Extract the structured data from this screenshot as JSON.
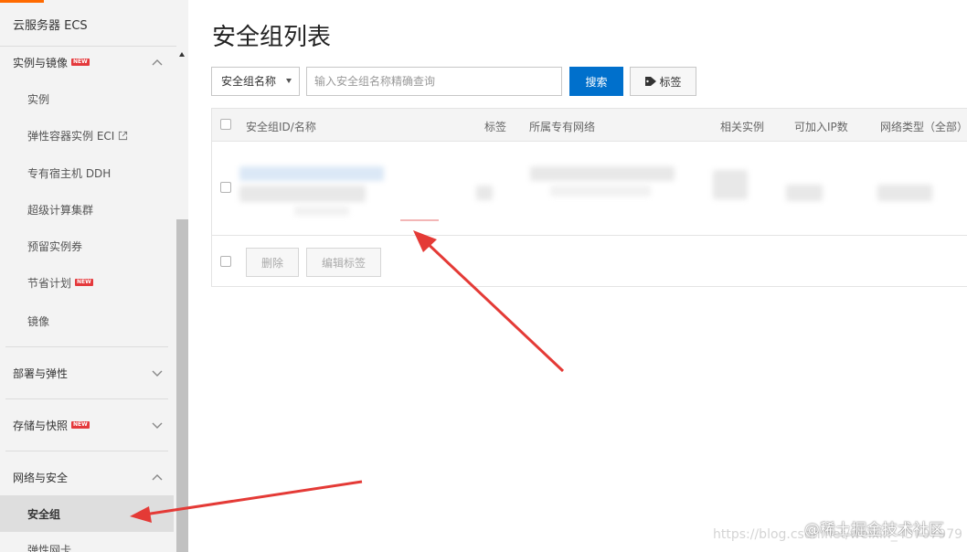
{
  "sidebar": {
    "product_title": "云服务器 ECS",
    "badge_new": "NEW",
    "sections": [
      {
        "label": "实例与镜像",
        "expanded": true,
        "has_new": true
      },
      {
        "label": "部署与弹性",
        "expanded": false,
        "has_new": false
      },
      {
        "label": "存储与快照",
        "expanded": false,
        "has_new": true
      },
      {
        "label": "网络与安全",
        "expanded": true,
        "has_new": false
      }
    ],
    "items": [
      {
        "label": "实例"
      },
      {
        "label": "弹性容器实例 ECI",
        "external_icon": "external-link-icon"
      },
      {
        "label": "专有宿主机 DDH"
      },
      {
        "label": "超级计算集群"
      },
      {
        "label": "预留实例券"
      },
      {
        "label": "节省计划",
        "has_new": true
      },
      {
        "label": "镜像"
      }
    ],
    "active_item": "安全组",
    "partial_item": "弹性网卡"
  },
  "main": {
    "title": "安全组列表",
    "search": {
      "type_selected": "安全组名称",
      "placeholder": "输入安全组名称精确查询",
      "search_button": "搜索",
      "tag_button": "标签",
      "tag_icon": "tag-icon"
    },
    "table": {
      "columns": [
        "安全组ID/名称",
        "标签",
        "所属专有网络",
        "相关实例",
        "可加入IP数",
        "网络类型（全部）"
      ],
      "footer_buttons": [
        "删除",
        "编辑标签"
      ]
    }
  },
  "watermark": {
    "url_text": "https://blog.csdn.net/weixin_43707979",
    "brand_text": "@稀土掘金技术社区"
  },
  "colors": {
    "accent_orange": "#ff6a00",
    "primary_blue": "#0070cc",
    "annotation_red": "#e43a36",
    "new_badge_red": "#e4393c"
  }
}
